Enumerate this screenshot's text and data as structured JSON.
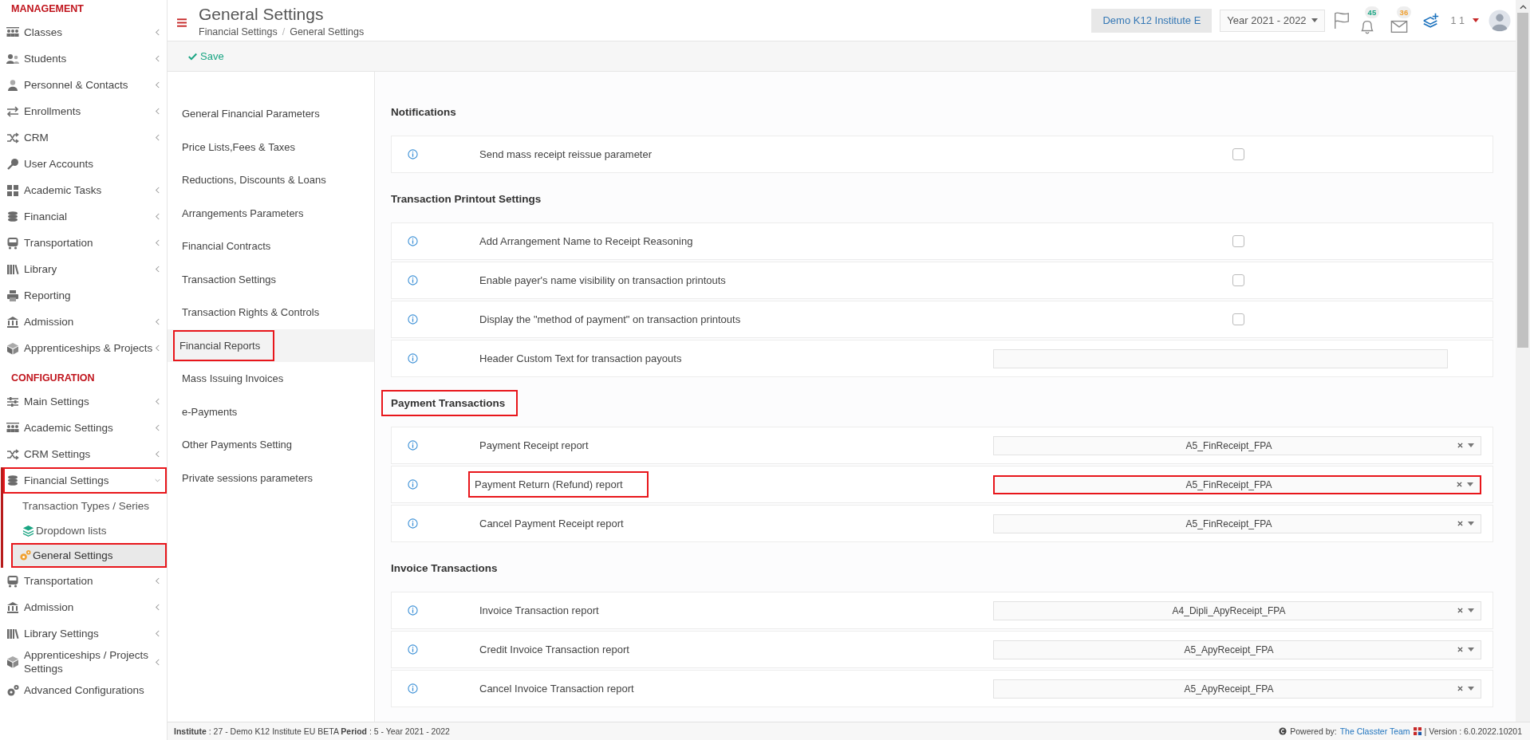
{
  "sidebar": {
    "sections": [
      {
        "title": "MANAGEMENT",
        "items": [
          {
            "label": "Classes",
            "has_submenu": true,
            "expanded": false,
            "highlighted": false
          },
          {
            "label": "Students",
            "has_submenu": true,
            "expanded": false,
            "highlighted": false
          },
          {
            "label": "Personnel & Contacts",
            "has_submenu": true,
            "expanded": false,
            "highlighted": false
          },
          {
            "label": "Enrollments",
            "has_submenu": true,
            "expanded": false,
            "highlighted": false
          },
          {
            "label": "CRM",
            "has_submenu": true,
            "expanded": false,
            "highlighted": false
          },
          {
            "label": "User Accounts",
            "has_submenu": false,
            "expanded": false,
            "highlighted": false
          },
          {
            "label": "Academic Tasks",
            "has_submenu": true,
            "expanded": false,
            "highlighted": false
          },
          {
            "label": "Financial",
            "has_submenu": true,
            "expanded": false,
            "highlighted": false
          },
          {
            "label": "Transportation",
            "has_submenu": true,
            "expanded": false,
            "highlighted": false
          },
          {
            "label": "Library",
            "has_submenu": true,
            "expanded": false,
            "highlighted": false
          },
          {
            "label": "Reporting",
            "has_submenu": false,
            "expanded": false,
            "highlighted": false
          },
          {
            "label": "Admission",
            "has_submenu": true,
            "expanded": false,
            "highlighted": false
          },
          {
            "label": "Apprenticeships & Projects",
            "has_submenu": true,
            "expanded": false,
            "highlighted": false
          }
        ]
      },
      {
        "title": "CONFIGURATION",
        "items": [
          {
            "label": "Main Settings",
            "has_submenu": true,
            "expanded": false,
            "highlighted": false
          },
          {
            "label": "Academic Settings",
            "has_submenu": true,
            "expanded": false,
            "highlighted": false
          },
          {
            "label": "CRM Settings",
            "has_submenu": true,
            "expanded": false,
            "highlighted": false
          },
          {
            "label": "Financial Settings",
            "has_submenu": true,
            "expanded": true,
            "highlighted": true,
            "children": [
              {
                "label": "Transaction Types / Series",
                "selected": false,
                "highlighted": false
              },
              {
                "label": "Dropdown lists",
                "selected": false,
                "highlighted": false
              },
              {
                "label": "General Settings",
                "selected": true,
                "highlighted": true
              }
            ]
          },
          {
            "label": "Transportation",
            "has_submenu": true,
            "expanded": false,
            "highlighted": false
          },
          {
            "label": "Admission",
            "has_submenu": true,
            "expanded": false,
            "highlighted": false
          },
          {
            "label": "Library Settings",
            "has_submenu": true,
            "expanded": false,
            "highlighted": false
          },
          {
            "label": "Apprenticeships / Projects Settings",
            "has_submenu": true,
            "expanded": false,
            "highlighted": false
          },
          {
            "label": "Advanced Configurations",
            "has_submenu": false,
            "expanded": false,
            "highlighted": false
          }
        ]
      }
    ]
  },
  "header": {
    "title": "General Settings",
    "breadcrumb": [
      "Financial Settings",
      "General Settings"
    ],
    "breadcrumb_separator": "/",
    "institute": "Demo K12 Institute E",
    "year": "Year 2021 - 2022",
    "notifications": "45",
    "messages": "36",
    "user": "1 1"
  },
  "toolbar": {
    "save": "Save"
  },
  "settings_nav": [
    {
      "label": "General Financial Parameters",
      "selected": false,
      "highlighted": false
    },
    {
      "label": "Price Lists,Fees & Taxes",
      "selected": false,
      "highlighted": false
    },
    {
      "label": "Reductions, Discounts & Loans",
      "selected": false,
      "highlighted": false
    },
    {
      "label": "Arrangements Parameters",
      "selected": false,
      "highlighted": false
    },
    {
      "label": "Financial Contracts",
      "selected": false,
      "highlighted": false
    },
    {
      "label": "Transaction Settings",
      "selected": false,
      "highlighted": false
    },
    {
      "label": "Transaction Rights & Controls",
      "selected": false,
      "highlighted": false
    },
    {
      "label": "Financial Reports",
      "selected": true,
      "highlighted": true
    },
    {
      "label": "Mass Issuing Invoices",
      "selected": false,
      "highlighted": false
    },
    {
      "label": "e-Payments",
      "selected": false,
      "highlighted": false
    },
    {
      "label": "Other Payments Setting",
      "selected": false,
      "highlighted": false
    },
    {
      "label": "Private sessions parameters",
      "selected": false,
      "highlighted": false
    }
  ],
  "sections": [
    {
      "title": "Notifications",
      "highlighted": false,
      "rows": [
        {
          "label": "Send mass receipt reissue parameter",
          "kind": "checkbox",
          "checked": false,
          "highlighted": false
        }
      ]
    },
    {
      "title": "Transaction Printout Settings",
      "highlighted": false,
      "rows": [
        {
          "label": "Add Arrangement Name to Receipt Reasoning",
          "kind": "checkbox",
          "checked": false,
          "highlighted": false
        },
        {
          "label": "Enable payer's name visibility on transaction printouts",
          "kind": "checkbox",
          "checked": false,
          "highlighted": false
        },
        {
          "label": "Display the \"method of payment\" on transaction printouts",
          "kind": "checkbox",
          "checked": false,
          "highlighted": false
        },
        {
          "label": "Header Custom Text for transaction payouts",
          "kind": "text",
          "highlighted": false
        }
      ]
    },
    {
      "title": "Payment Transactions",
      "highlighted": true,
      "rows": [
        {
          "label": "Payment Receipt report",
          "kind": "select",
          "value": "A5_FinReceipt_FPA",
          "highlighted": false,
          "control_highlighted": false
        },
        {
          "label": "Payment Return (Refund) report",
          "kind": "select",
          "value": "A5_FinReceipt_FPA",
          "highlighted": true,
          "control_highlighted": true
        },
        {
          "label": "Cancel Payment Receipt report",
          "kind": "select",
          "value": "A5_FinReceipt_FPA",
          "highlighted": false,
          "control_highlighted": false
        }
      ]
    },
    {
      "title": "Invoice Transactions",
      "highlighted": false,
      "rows": [
        {
          "label": "Invoice Transaction report",
          "kind": "select",
          "value": "A4_Dipli_ApyReceipt_FPA",
          "highlighted": false,
          "control_highlighted": false
        },
        {
          "label": "Credit Invoice Transaction report",
          "kind": "select",
          "value": "A5_ApyReceipt_FPA",
          "highlighted": false,
          "control_highlighted": false
        },
        {
          "label": "Cancel Invoice Transaction report",
          "kind": "select",
          "value": "A5_ApyReceipt_FPA",
          "highlighted": false,
          "control_highlighted": false
        }
      ]
    }
  ],
  "footer": {
    "info": "**Institute** : 27 - Demo K12 Institute EU BETA **Period** : 5 - Year 2021 - 2022",
    "powered_by": "Powered by:",
    "team": "The Classter Team",
    "version": "| Version : 6.0.2022.10201"
  }
}
